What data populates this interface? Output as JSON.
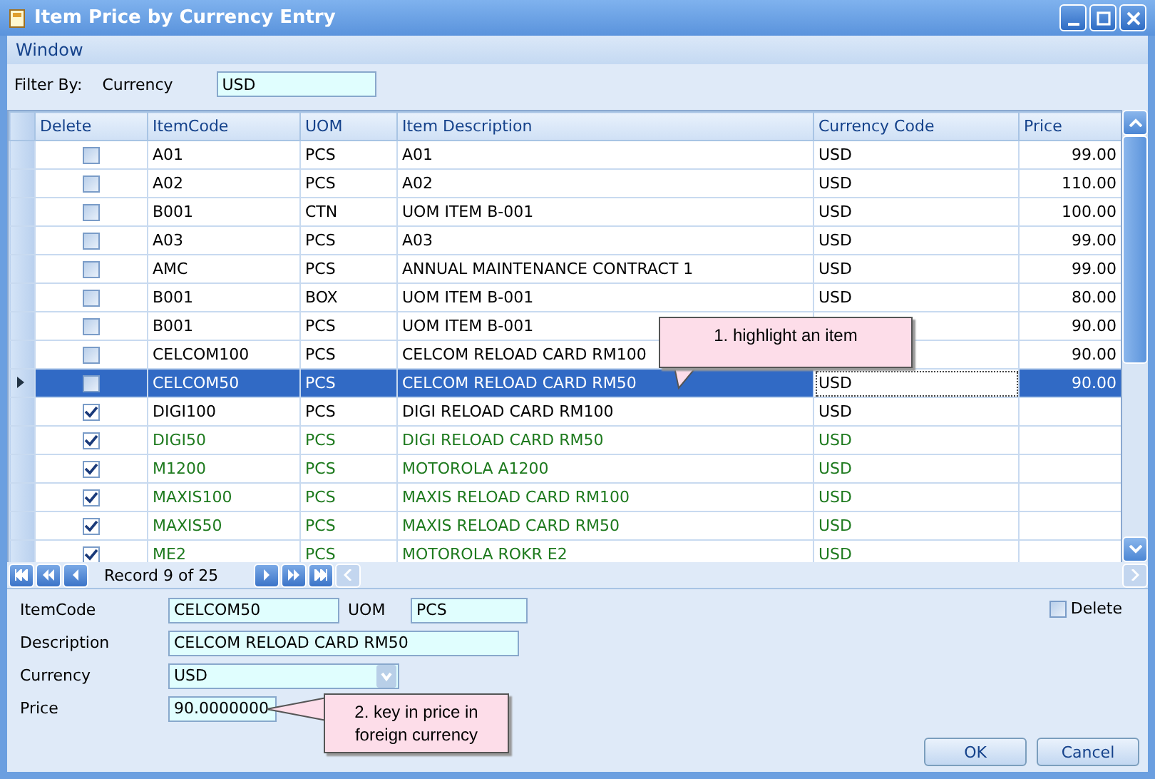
{
  "window": {
    "title": "Item Price by Currency Entry"
  },
  "menu": [
    "Window"
  ],
  "filter": {
    "label": "Filter By:",
    "field_label": "Currency",
    "value": "USD"
  },
  "table": {
    "columns": [
      "Delete",
      "ItemCode",
      "UOM",
      "Item Description",
      "Currency Code",
      "Price"
    ],
    "rows": [
      {
        "delete": false,
        "code": "A01",
        "uom": "PCS",
        "description": "A01",
        "currency": "USD",
        "price": "99.00",
        "selected": false,
        "color": "#000000"
      },
      {
        "delete": false,
        "code": "A02",
        "uom": "PCS",
        "description": "A02",
        "currency": "USD",
        "price": "110.00",
        "selected": false,
        "color": "#000000"
      },
      {
        "delete": false,
        "code": "B001",
        "uom": "CTN",
        "description": "UOM ITEM B-001",
        "currency": "USD",
        "price": "100.00",
        "selected": false,
        "color": "#000000"
      },
      {
        "delete": false,
        "code": "A03",
        "uom": "PCS",
        "description": "A03",
        "currency": "USD",
        "price": "99.00",
        "selected": false,
        "color": "#000000"
      },
      {
        "delete": false,
        "code": "AMC",
        "uom": "PCS",
        "description": "ANNUAL MAINTENANCE CONTRACT 1",
        "currency": "USD",
        "price": "99.00",
        "selected": false,
        "color": "#000000"
      },
      {
        "delete": false,
        "code": "B001",
        "uom": "BOX",
        "description": "UOM ITEM B-001",
        "currency": "USD",
        "price": "80.00",
        "selected": false,
        "color": "#000000"
      },
      {
        "delete": false,
        "code": "B001",
        "uom": "PCS",
        "description": "UOM ITEM B-001",
        "price": "90.00",
        "selected": false,
        "color": "#000000"
      },
      {
        "delete": false,
        "code": "CELCOM100",
        "uom": "PCS",
        "description": "CELCOM RELOAD CARD RM100",
        "price": "90.00",
        "selected": false,
        "color": "#000000"
      },
      {
        "delete": false,
        "code": "CELCOM50",
        "uom": "PCS",
        "description": "CELCOM RELOAD CARD RM50",
        "currency": "USD",
        "price": "90.00",
        "selected": true,
        "color": "#000000"
      },
      {
        "delete": true,
        "code": "DIGI100",
        "uom": "PCS",
        "description": "DIGI RELOAD CARD RM100",
        "currency": "USD",
        "selected": false,
        "color": "#000000"
      },
      {
        "delete": true,
        "code": "DIGI50",
        "uom": "PCS",
        "description": "DIGI RELOAD CARD RM50",
        "currency": "USD",
        "selected": false,
        "color": "#1e7a1e"
      },
      {
        "delete": true,
        "code": "M1200",
        "uom": "PCS",
        "description": "MOTOROLA A1200",
        "currency": "USD",
        "selected": false,
        "color": "#1e7a1e"
      },
      {
        "delete": true,
        "code": "MAXIS100",
        "uom": "PCS",
        "description": "MAXIS RELOAD CARD RM100",
        "currency": "USD",
        "selected": false,
        "color": "#1e7a1e"
      },
      {
        "delete": true,
        "code": "MAXIS50",
        "uom": "PCS",
        "description": "MAXIS RELOAD CARD RM50",
        "currency": "USD",
        "selected": false,
        "color": "#1e7a1e"
      },
      {
        "delete": true,
        "code": "ME2",
        "uom": "PCS",
        "description": "MOTOROLA ROKR E2",
        "currency": "USD",
        "selected": false,
        "color": "#1e7a1e"
      }
    ]
  },
  "navigator": {
    "record": "Record 9 of 25"
  },
  "form": {
    "item_code": {
      "label": "ItemCode",
      "value": "CELCOM50"
    },
    "uom": {
      "label": "UOM",
      "value": "PCS"
    },
    "description": {
      "label": "Description",
      "value": "CELCOM RELOAD CARD RM50"
    },
    "currency": {
      "label": "Currency",
      "value": "USD"
    },
    "price": {
      "label": "Price",
      "value": "90.0000000"
    },
    "delete": {
      "label": "Delete",
      "checked": false
    }
  },
  "callouts": [
    "1. highlight an item",
    "2. key in price in foreign currency"
  ],
  "buttons": [
    "OK",
    "Cancel"
  ]
}
